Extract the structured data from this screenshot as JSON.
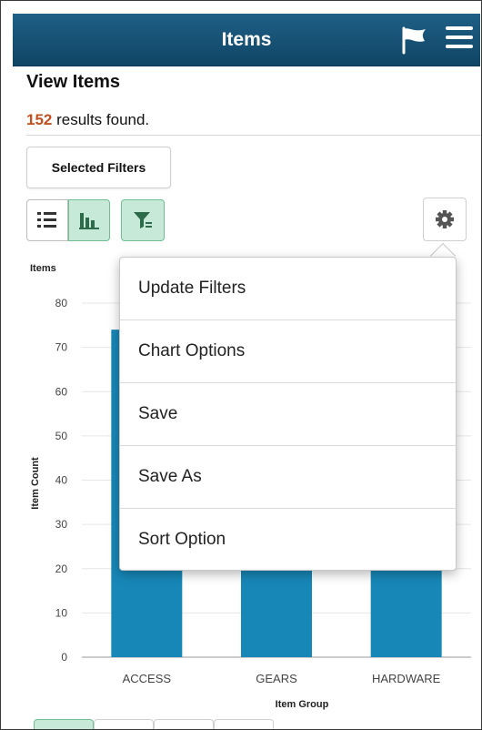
{
  "header": {
    "title": "Items",
    "flag_icon": "flag-icon",
    "menu_icon": "hamburger-menu-icon",
    "bg_color": "#14506f"
  },
  "page": {
    "title": "View Items",
    "result_count": "152",
    "result_suffix": " results found.",
    "selected_filters_label": "Selected Filters"
  },
  "toolbar": {
    "list_view_icon": "list-view-icon",
    "chart_view_icon": "bar-chart-icon",
    "filter_icon": "filter-icon",
    "settings_icon": "gear-icon",
    "active_color": "#c7ead8"
  },
  "popup_menu": {
    "items": [
      "Update Filters",
      "Chart Options",
      "Save",
      "Save As",
      "Sort Option"
    ]
  },
  "chart_data": {
    "type": "bar",
    "title": "Items",
    "xlabel": "Item Group",
    "ylabel": "Item Count",
    "categories": [
      "ACCESS",
      "GEARS",
      "HARDWARE"
    ],
    "values": [
      74,
      25,
      25
    ],
    "ylim": [
      0,
      80
    ],
    "yticks": [
      0,
      10,
      20,
      30,
      40,
      50,
      60,
      70,
      80
    ],
    "bar_color": "#1787b7",
    "grid": true
  }
}
